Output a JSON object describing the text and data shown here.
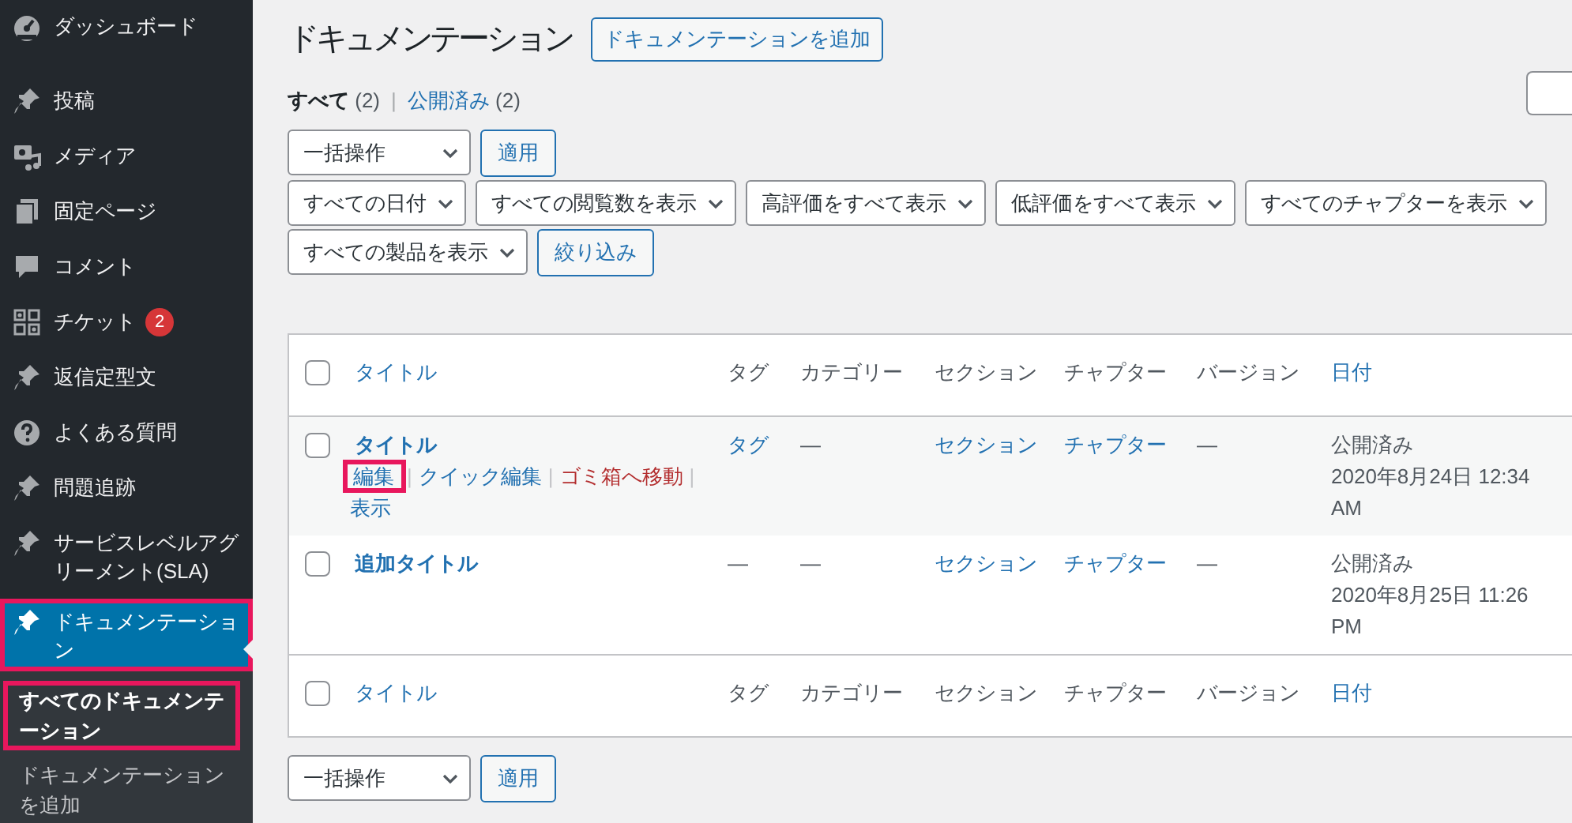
{
  "sidebar": {
    "items": [
      {
        "label": "ダッシュボード",
        "current": false,
        "highlighted": false
      },
      {
        "label": "投稿",
        "current": false,
        "highlighted": false
      },
      {
        "label": "メディア",
        "current": false,
        "highlighted": false
      },
      {
        "label": "固定ページ",
        "current": false,
        "highlighted": false
      },
      {
        "label": "コメント",
        "current": false,
        "highlighted": false
      },
      {
        "label": "チケット",
        "badge": "2",
        "current": false,
        "highlighted": false
      },
      {
        "label": "返信定型文",
        "current": false,
        "highlighted": false
      },
      {
        "label": "よくある質問",
        "current": false,
        "highlighted": false
      },
      {
        "label": "問題追跡",
        "current": false,
        "highlighted": false
      },
      {
        "label": "サービスレベルアグリーメント(SLA)",
        "current": false,
        "highlighted": false
      },
      {
        "label": "ドキュメンテーション",
        "current": true,
        "highlighted": true,
        "children": [
          {
            "label": "すべてのドキュメンテーション",
            "selected": true,
            "highlighted": true
          },
          {
            "label": "ドキュメンテーションを追加",
            "selected": false,
            "highlighted": false
          }
        ]
      }
    ]
  },
  "page": {
    "title": "ドキュメンテーション",
    "add_button": "ドキュメンテーションを追加"
  },
  "status_links": [
    {
      "label": "すべて",
      "count": "(2)",
      "selected": true,
      "separator": "|"
    },
    {
      "label": "公開済み",
      "count": "(2)",
      "selected": false
    }
  ],
  "bulk_top": {
    "select": "一括操作",
    "button": "適用"
  },
  "filter_rows": [
    {
      "selects": [
        "すべての日付",
        "すべての閲覧数を表示",
        "高評価をすべて表示",
        "低評価をすべて表示",
        "すべてのチャプターを表示"
      ]
    },
    {
      "selects": [
        "すべての製品を表示"
      ],
      "button": "絞り込み"
    }
  ],
  "table": {
    "header_checked": false,
    "columns": [
      {
        "label": "タイトル",
        "kind": "sortable"
      },
      {
        "label": "タグ",
        "kind": "plain"
      },
      {
        "label": "カテゴリー",
        "kind": "plain"
      },
      {
        "label": "セクション",
        "kind": "plain"
      },
      {
        "label": "チャプター",
        "kind": "plain"
      },
      {
        "label": "バージョン",
        "kind": "plain"
      },
      {
        "label": "日付",
        "kind": "sortable"
      }
    ],
    "rows": [
      {
        "checked": false,
        "cells": [
          {
            "kind": "title",
            "text": "タイトル",
            "actions": [
              {
                "label": "編集",
                "kind": "normal",
                "highlighted": true,
                "separator": "|"
              },
              {
                "label": "クイック編集",
                "kind": "normal",
                "highlighted": false,
                "separator": "|"
              },
              {
                "label": "ゴミ箱へ移動",
                "kind": "trash",
                "highlighted": false,
                "separator": "|"
              },
              {
                "label": "表示",
                "kind": "normal",
                "highlighted": false
              }
            ]
          },
          {
            "kind": "link",
            "text": "タグ"
          },
          {
            "kind": "text",
            "text": "—"
          },
          {
            "kind": "link",
            "text": "セクション"
          },
          {
            "kind": "link",
            "text": "チャプター"
          },
          {
            "kind": "text",
            "text": "—"
          },
          {
            "kind": "date",
            "status": "公開済み",
            "text": "2020年8月24日 12:34 AM"
          }
        ]
      },
      {
        "checked": false,
        "cells": [
          {
            "kind": "title",
            "text": "追加タイトル"
          },
          {
            "kind": "text",
            "text": "—"
          },
          {
            "kind": "text",
            "text": "—"
          },
          {
            "kind": "link",
            "text": "セクション"
          },
          {
            "kind": "link",
            "text": "チャプター"
          },
          {
            "kind": "text",
            "text": "—"
          },
          {
            "kind": "date",
            "status": "公開済み",
            "text": "2020年8月25日 11:26 PM"
          }
        ]
      }
    ],
    "footer_checked": false,
    "footer_columns": [
      {
        "label": "タイトル",
        "kind": "sortable"
      },
      {
        "label": "タグ",
        "kind": "plain"
      },
      {
        "label": "カテゴリー",
        "kind": "plain"
      },
      {
        "label": "セクション",
        "kind": "plain"
      },
      {
        "label": "チャプター",
        "kind": "plain"
      },
      {
        "label": "バージョン",
        "kind": "plain"
      },
      {
        "label": "日付",
        "kind": "sortable"
      }
    ]
  },
  "bulk_bottom": {
    "select": "一括操作",
    "button": "適用"
  }
}
